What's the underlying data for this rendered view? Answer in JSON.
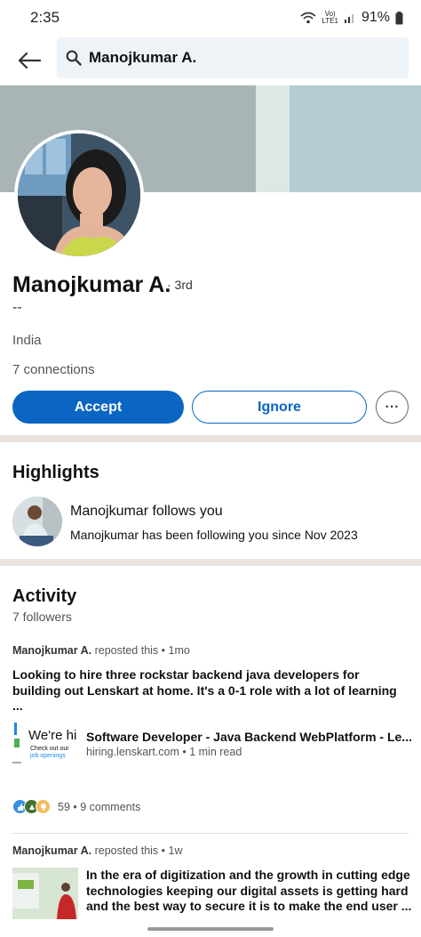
{
  "status_bar": {
    "time": "2:35",
    "network_top": "Vo)",
    "network_bottom": "LTE1",
    "battery": "91%"
  },
  "search": {
    "query": "Manojkumar A."
  },
  "profile": {
    "name": "Manojkumar A.",
    "degree": "· 3rd",
    "headline": "--",
    "location": "India",
    "connections": "7 connections"
  },
  "actions": {
    "accept_label": "Accept",
    "ignore_label": "Ignore",
    "more_label": "···"
  },
  "highlights": {
    "heading": "Highlights",
    "title": "Manojkumar follows you",
    "subtitle": "Manojkumar has been following you since Nov 2023"
  },
  "activity": {
    "heading": "Activity",
    "followers": "7 followers",
    "posts": [
      {
        "author": "Manojkumar A.",
        "meta": " reposted this • 1mo",
        "text": "Looking to hire three rockstar backend java developers for building out Lenskart at home. It's a 0-1 role with a lot of learning ...",
        "attachment": {
          "thumb_title": "We're hi",
          "thumb_sub1": "Check out our",
          "thumb_sub2": "job openings",
          "title": "Software Developer - Java Backend WebPlatform - Le...",
          "subtitle": "hiring.lenskart.com • 1 min read"
        },
        "reactions": "59",
        "comments": "• 9 comments"
      },
      {
        "author": "Manojkumar A.",
        "meta": " reposted this • 1w",
        "text": "In the era of digitization and the growth in cutting edge technologies keeping our digital assets is getting hard and the best way to secure it is to make the end user ..."
      }
    ]
  },
  "colors": {
    "primary": "#0a66c2",
    "divider": "#ebe4de",
    "search_bg": "#eef3f8"
  }
}
